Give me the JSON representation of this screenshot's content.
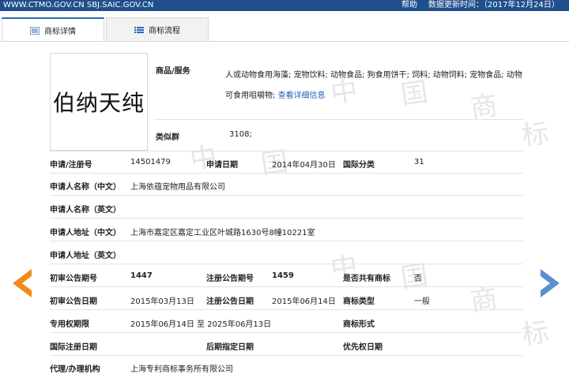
{
  "topbar": {
    "site": "WWW.CTMO.GOV.CN SBJ.SAIC.GOV.CN",
    "help": "帮助",
    "update": "数据更新时间：（2017年12月24日）"
  },
  "tabs": [
    {
      "label": "商标详情",
      "icon": "list-icon"
    },
    {
      "label": "商标流程",
      "icon": "list-icon"
    }
  ],
  "watermark": [
    "中",
    "国",
    "商",
    "标"
  ],
  "mark": {
    "image_text": "伯纳天纯",
    "goods_label": "商品/服务",
    "goods_value": "人或动物食用海藻; 宠物饮料; 动物食品; 狗食用饼干; 饲料; 动物饲料; 宠物食品; 动物可食用咀嚼物;",
    "goods_link": "查看详细信息",
    "similar_label": "类似群",
    "similar_value": "3108;"
  },
  "fields": {
    "reg_no_label": "申请/注册号",
    "reg_no": "14501479",
    "apply_date_label": "申请日期",
    "apply_date": "2014年04月30日",
    "intl_class_label": "国际分类",
    "intl_class": "31",
    "applicant_cn_label": "申请人名称（中文）",
    "applicant_cn": "上海依蕴宠物用品有限公司",
    "applicant_en_label": "申请人名称（英文）",
    "address_cn_label": "申请人地址（中文）",
    "address_cn": "上海市嘉定区嘉定工业区叶城路1630号8幢10221室",
    "address_en_label": "申请人地址（英文）",
    "prelim_no_label": "初审公告期号",
    "prelim_no": "1447",
    "reg_pub_no_label": "注册公告期号",
    "reg_pub_no": "1459",
    "shared_label": "是否共有商标",
    "shared": "否",
    "prelim_date_label": "初审公告日期",
    "prelim_date": "2015年03月13日",
    "reg_pub_date_label": "注册公告日期",
    "reg_pub_date": "2015年06月14日",
    "mark_type_label": "商标类型",
    "mark_type": "一般",
    "exclusive_label": "专用权期限",
    "exclusive": "2015年06月14日 至 2025年06月13日",
    "mark_form_label": "商标形式",
    "intl_reg_date_label": "国际注册日期",
    "later_date_label": "后期指定日期",
    "priority_label": "优先权日期",
    "agent_label": "代理/办理机构",
    "agent": "上海专利商标事务所有限公司"
  },
  "colors": {
    "topbar": "#1f4f8c",
    "prev_arrow": "#f08a1c",
    "next_arrow": "#5a8fd0",
    "link": "#1f5fb4"
  },
  "nav": {
    "prev": "chevron-left-icon",
    "next": "chevron-right-icon"
  }
}
